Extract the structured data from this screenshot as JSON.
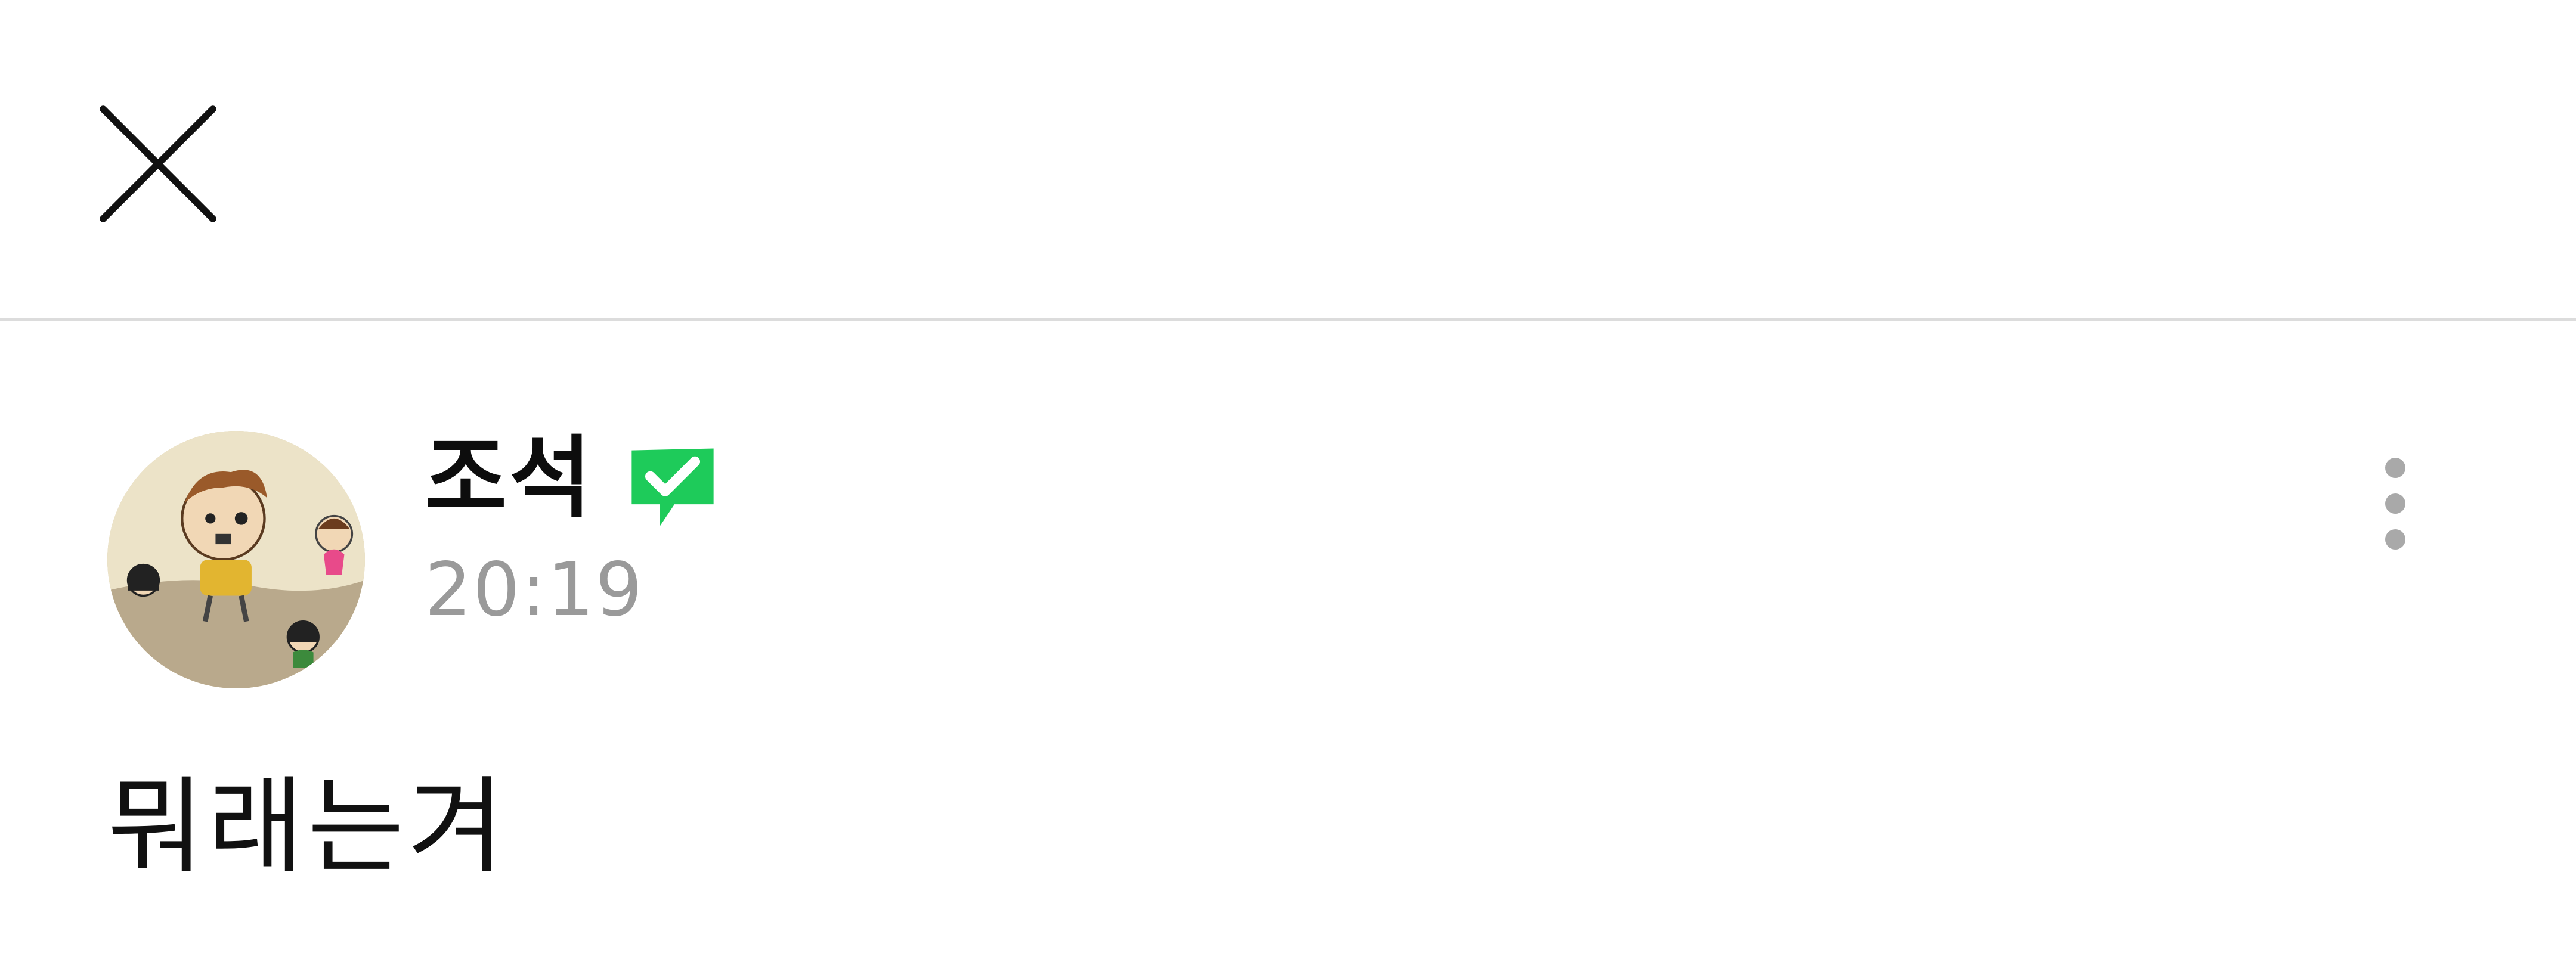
{
  "header": {
    "close_icon": "close-icon"
  },
  "post": {
    "author": {
      "name": "조석",
      "verified_icon": "verified-check-icon",
      "verified_color": "#1ecb5a"
    },
    "time": "20:19",
    "more_icon": "more-vertical-icon",
    "body": "뭐래는겨"
  }
}
